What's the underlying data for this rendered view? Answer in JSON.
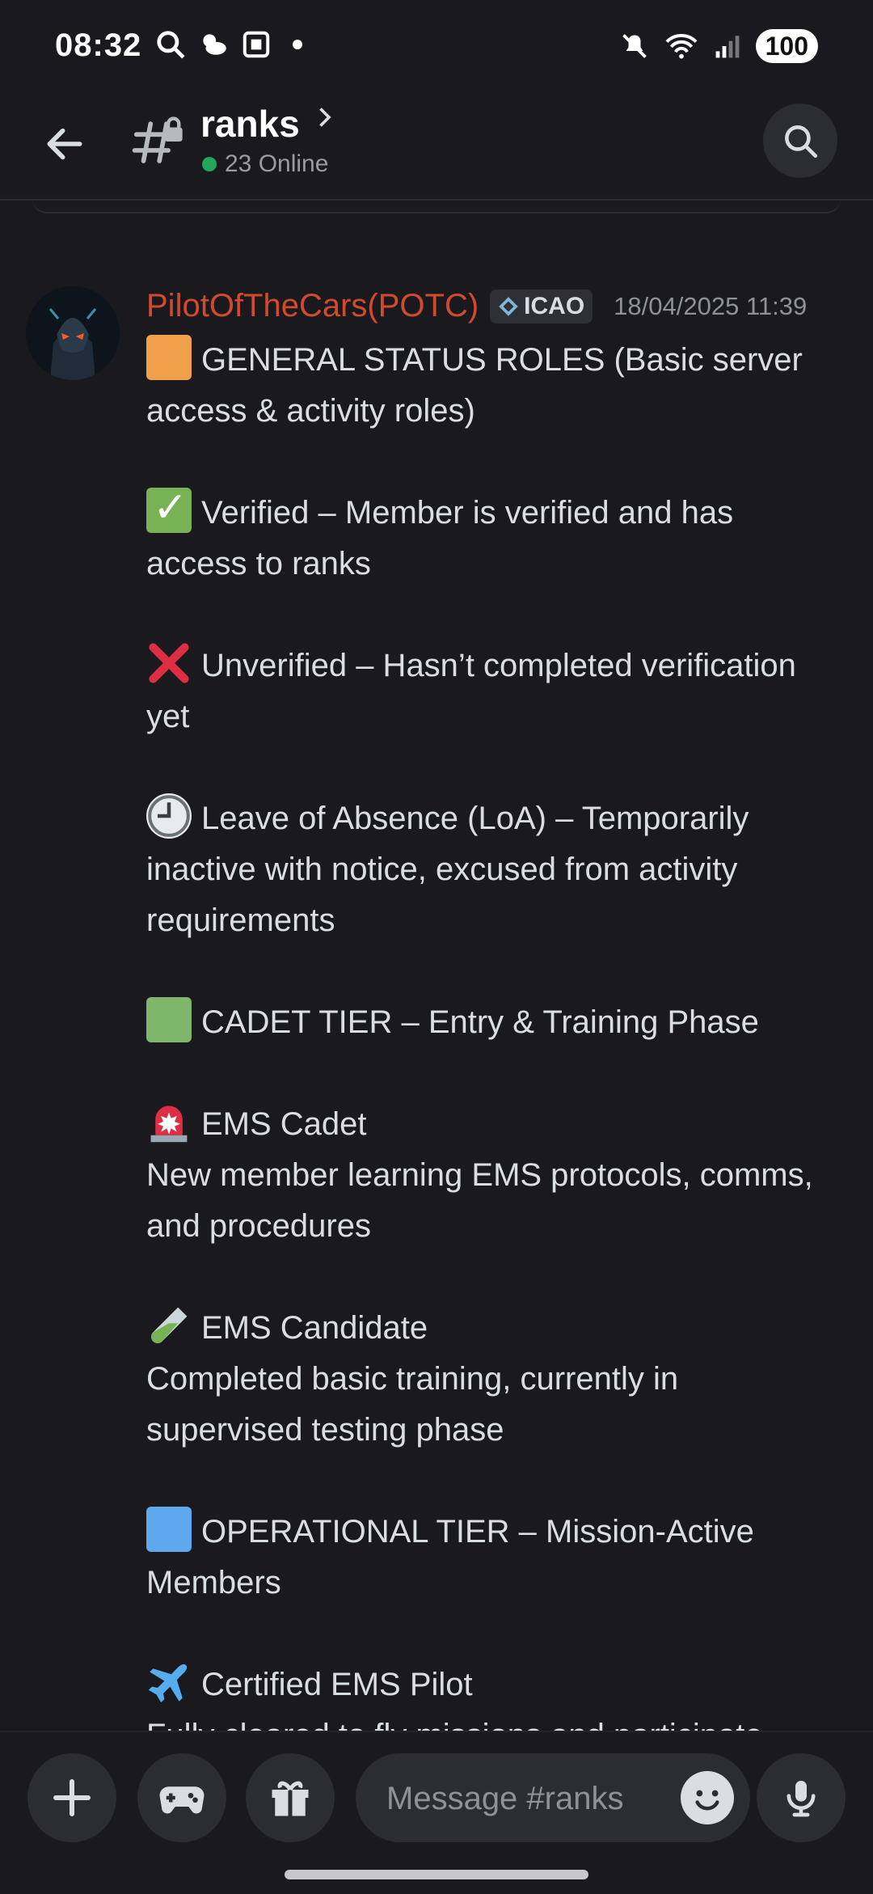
{
  "status_bar": {
    "time": "08:32",
    "battery": "100",
    "icons": [
      "search-icon",
      "weather-icon",
      "screenshot-icon",
      "dot-icon",
      "mute-icon",
      "wifi-icon",
      "signal-icon"
    ]
  },
  "header": {
    "channel_name": "ranks",
    "online_count": "23 Online",
    "online_color": "#23a55a"
  },
  "message": {
    "author": "PilotOfTheCars(POTC)",
    "author_color": "#d24a2e",
    "tag": "ICAO",
    "timestamp": "18/04/2025 11:39",
    "paragraphs": [
      {
        "emoji": "orange-square",
        "text": "GENERAL STATUS ROLES (Basic server access & activity roles)"
      },
      {
        "emoji": "check-mark",
        "text": "Verified – Member is verified and has access to ranks"
      },
      {
        "emoji": "cross-mark",
        "text": "Unverified – Hasn’t completed verification yet"
      },
      {
        "emoji": "clock",
        "text": "Leave of Absence (LoA) – Temporarily inactive with notice, excused from activity requirements"
      },
      {
        "emoji": "green-square",
        "text": "CADET TIER – Entry & Training Phase"
      },
      {
        "emoji": "siren",
        "text": "EMS Cadet",
        "text2": "New member learning EMS protocols, comms, and procedures"
      },
      {
        "emoji": "test-tube",
        "text": "EMS Candidate",
        "text2": "Completed basic training, currently in supervised testing phase"
      },
      {
        "emoji": "blue-square",
        "text": "OPERATIONAL TIER – Mission-Active Members"
      },
      {
        "emoji": "airplane",
        "text": "Certified EMS Pilot",
        "text2": "Fully cleared to fly missions and participate"
      }
    ]
  },
  "composer": {
    "placeholder": "Message #ranks"
  }
}
